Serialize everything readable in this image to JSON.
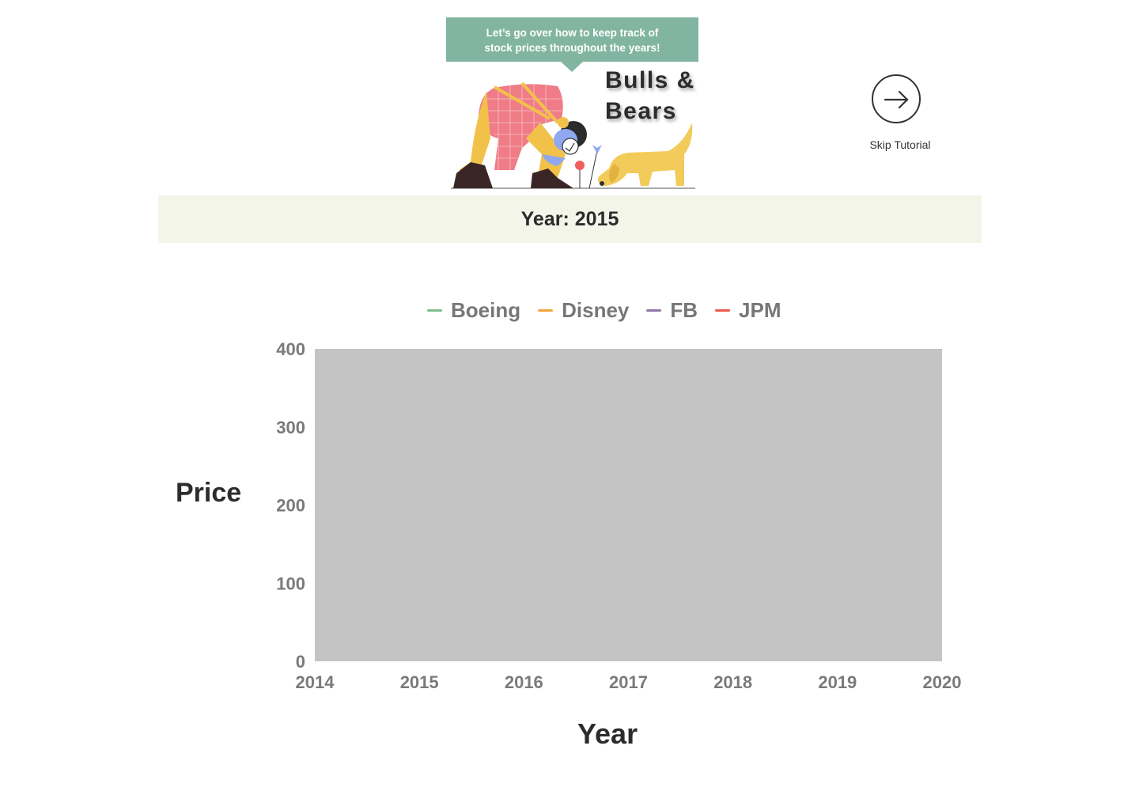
{
  "tutorial": {
    "bubble_line1": "Let’s go over how to keep track of",
    "bubble_line2": "stock prices throughout the years!",
    "bubble_color": "#82b5a1",
    "title_line1": "Bulls &",
    "title_line2": "Bears",
    "skip_label": "Skip Tutorial",
    "skip_icon": "arrow-right-icon"
  },
  "year_banner": {
    "label": "Year: 2015",
    "background": "#f2f5e8"
  },
  "chart_data": {
    "type": "line",
    "title": "",
    "xlabel": "Year",
    "ylabel": "Price",
    "x_ticks": [
      "2014",
      "2015",
      "2016",
      "2017",
      "2018",
      "2019",
      "2020"
    ],
    "y_ticks": [
      "0",
      "100",
      "200",
      "300",
      "400"
    ],
    "xlim": [
      2014,
      2020
    ],
    "ylim": [
      0,
      400
    ],
    "plot_background": "#c4c4c4",
    "legend_position": "top",
    "series": [
      {
        "name": "Boeing",
        "color": "#7fbf8f",
        "values": []
      },
      {
        "name": "Disney",
        "color": "#f5a33a",
        "values": []
      },
      {
        "name": "FB",
        "color": "#8e78a8",
        "values": []
      },
      {
        "name": "JPM",
        "color": "#ee5a4a",
        "values": []
      }
    ]
  }
}
